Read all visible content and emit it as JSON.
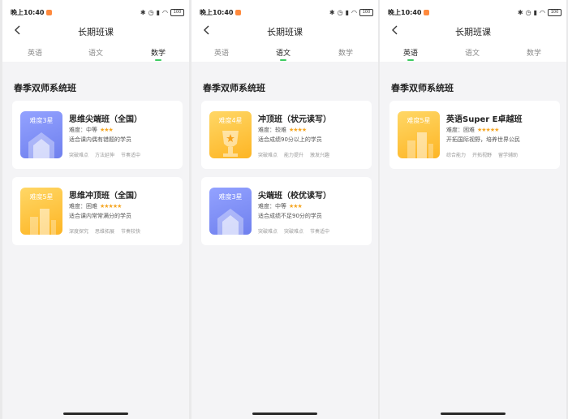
{
  "screens": [
    {
      "status_time": "晚上10:40",
      "status_battery": "100",
      "title": "长期班课",
      "tabs": [
        "英语",
        "语文",
        "数学"
      ],
      "active_tab": 2,
      "section_title": "春季双师系统班",
      "cards": [
        {
          "level": "难度3星",
          "color": "blue",
          "name": "思维尖端班（全国）",
          "difficulty_label": "难度：",
          "difficulty": "中等",
          "stars": "★★★",
          "desc": "适合课内偶有错题的学员",
          "tags": [
            "突破难点",
            "方法延伸",
            "节奏适中"
          ]
        },
        {
          "level": "难度5星",
          "color": "yellow",
          "name": "思维冲顶班（全国）",
          "difficulty_label": "难度：",
          "difficulty": "困难",
          "stars": "★★★★★",
          "desc": "适合课内常常满分的学员",
          "tags": [
            "深度探究",
            "思维拓展",
            "节奏较快"
          ]
        }
      ]
    },
    {
      "status_time": "晚上10:40",
      "status_battery": "100",
      "title": "长期班课",
      "tabs": [
        "英语",
        "语文",
        "数学"
      ],
      "active_tab": 1,
      "section_title": "春季双师系统班",
      "cards": [
        {
          "level": "难度4星",
          "color": "yellow",
          "name": "冲顶班（状元读写）",
          "difficulty_label": "难度：",
          "difficulty": "较难",
          "stars": "★★★★",
          "desc": "适合成绩90分以上的学员",
          "tags": [
            "突破难点",
            "能力提升",
            "激发兴趣"
          ]
        },
        {
          "level": "难度3星",
          "color": "blue",
          "name": "尖端班（校优读写）",
          "difficulty_label": "难度：",
          "difficulty": "中等",
          "stars": "★★★",
          "desc": "适合成绩不足90分的学员",
          "tags": [
            "突破难点",
            "突破难点",
            "节奏适中"
          ]
        }
      ]
    },
    {
      "status_time": "晚上10:40",
      "status_battery": "100",
      "title": "长期班课",
      "tabs": [
        "英语",
        "语文",
        "数学"
      ],
      "active_tab": 0,
      "section_title": "春季双师系统班",
      "cards": [
        {
          "level": "难度5星",
          "color": "yellow",
          "name": "英语Super E卓越班",
          "difficulty_label": "难度：",
          "difficulty": "困难",
          "stars": "★★★★★",
          "desc": "开拓国际视野，培养世界公民",
          "tags": [
            "综合能力",
            "开拓视野",
            "留学辅助"
          ]
        }
      ]
    }
  ],
  "colors": {
    "accent_green": "#3ecb62",
    "star": "#f5a623",
    "thumb_blue": "#7f8ff5",
    "thumb_yellow": "#fdc23e"
  },
  "icons": [
    "back-chevron-icon",
    "signal-icon",
    "wifi-icon",
    "alarm-icon",
    "bluetooth-icon",
    "battery-icon"
  ]
}
